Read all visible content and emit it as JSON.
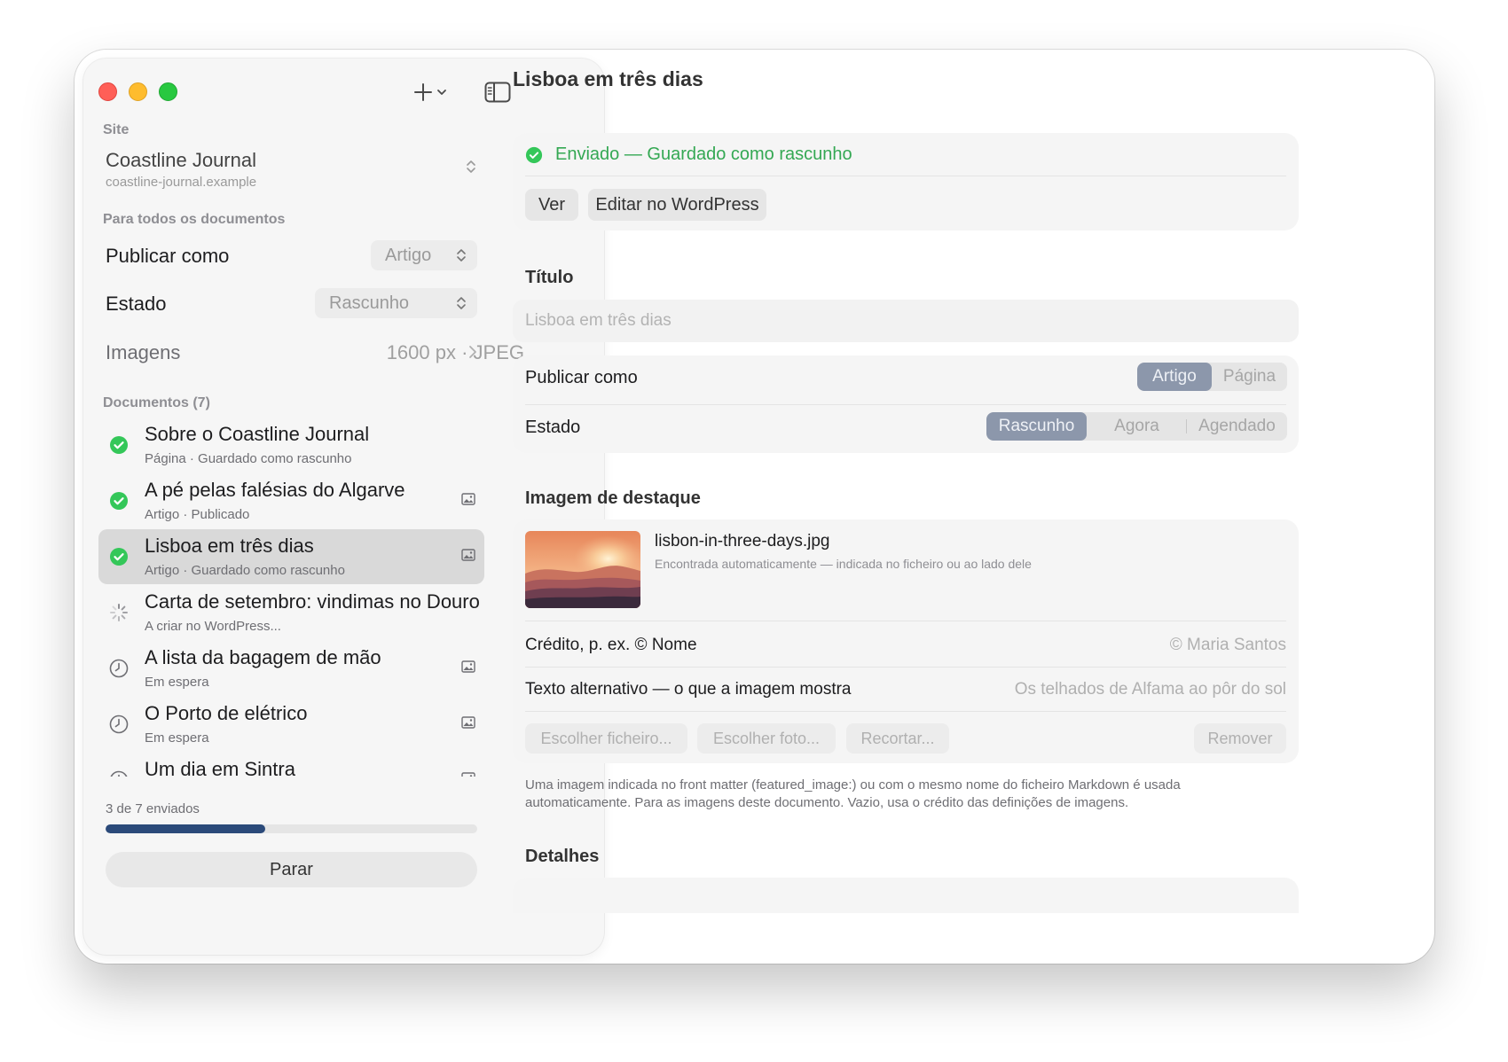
{
  "window": {
    "traffic_lights": [
      "close",
      "minimize",
      "zoom"
    ],
    "toolbar": {
      "add_icon": "plus-icon",
      "add_menu_icon": "chevron-down-icon",
      "toggle_icon": "sidebar-toggle-icon"
    }
  },
  "sidebar": {
    "site_label": "Site",
    "site_name": "Coastline Journal",
    "site_url": "coastline-journal.example",
    "all_docs_label": "Para todos os documentos",
    "publish_as_label": "Publicar como",
    "publish_as_value": "Artigo",
    "status_label": "Estado",
    "status_value": "Rascunho",
    "images_label": "Imagens",
    "images_value": "1600 px · JPEG",
    "documents_label": "Documentos (7)",
    "documents": [
      {
        "title": "Sobre o Coastline Journal",
        "subtitle": "Página · Guardado como rascunho",
        "state": "done",
        "has_image": false
      },
      {
        "title": "A pé pelas falésias do Algarve",
        "subtitle": "Artigo · Publicado",
        "state": "done",
        "has_image": true
      },
      {
        "title": "Lisboa em três dias",
        "subtitle": "Artigo · Guardado como rascunho",
        "state": "done",
        "has_image": true,
        "selected": true
      },
      {
        "title": "Carta de setembro: vindimas no Douro",
        "subtitle": "A criar no WordPress...",
        "state": "in-progress",
        "has_image": false
      },
      {
        "title": "A lista da bagagem de mão",
        "subtitle": "Em espera",
        "state": "waiting",
        "has_image": true
      },
      {
        "title": "O Porto de elétrico",
        "subtitle": "Em espera",
        "state": "waiting",
        "has_image": true
      },
      {
        "title": "Um dia em Sintra",
        "subtitle": "",
        "state": "waiting",
        "has_image": true
      }
    ],
    "progress_text": "3 de 7 enviados",
    "progress_fraction": 0.43,
    "stop_label": "Parar"
  },
  "main": {
    "title": "Lisboa em três dias",
    "status_text": "Enviado — Guardado como rascunho",
    "view_button": "Ver",
    "edit_button": "Editar no WordPress",
    "title_section": "Título",
    "title_placeholder": "Lisboa em três dias",
    "publish_as_label": "Publicar como",
    "publish_as_options": [
      "Artigo",
      "Página"
    ],
    "publish_as_selected": "Artigo",
    "status_label": "Estado",
    "status_options": [
      "Rascunho",
      "Agora",
      "Agendado"
    ],
    "status_selected": "Rascunho",
    "featured_section": "Imagem de destaque",
    "file_name": "lisbon-in-three-days.jpg",
    "file_note": "Encontrada automaticamente — indicada no ficheiro ou ao lado dele",
    "credit_label": "Crédito, p. ex. © Nome",
    "credit_placeholder": "© Maria Santos",
    "alt_label": "Texto alternativo — o que a imagem mostra",
    "alt_placeholder": "Os telhados de Alfama ao pôr do sol",
    "choose_file": "Escolher ficheiro...",
    "choose_photo": "Escolher foto...",
    "crop": "Recortar...",
    "remove": "Remover",
    "help_text": "Uma imagem indicada no front matter (featured_image:) ou com o mesmo nome do ficheiro Markdown é usada automaticamente. Para as imagens deste documento. Vazio, usa o crédito das definições de imagens.",
    "details_section": "Detalhes"
  },
  "colors": {
    "success": "#34a853",
    "segment_selected": "#8c97ab",
    "progress": "#2b4a7a"
  }
}
